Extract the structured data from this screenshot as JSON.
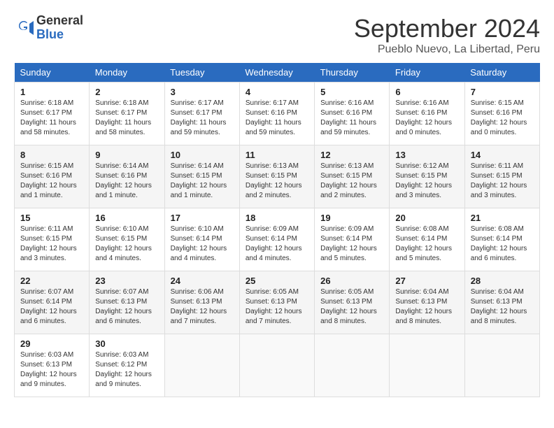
{
  "logo": {
    "general": "General",
    "blue": "Blue"
  },
  "header": {
    "month": "September 2024",
    "location": "Pueblo Nuevo, La Libertad, Peru"
  },
  "days_of_week": [
    "Sunday",
    "Monday",
    "Tuesday",
    "Wednesday",
    "Thursday",
    "Friday",
    "Saturday"
  ],
  "weeks": [
    [
      {
        "day": "1",
        "sunrise": "6:18 AM",
        "sunset": "6:17 PM",
        "daylight": "11 hours and 58 minutes."
      },
      {
        "day": "2",
        "sunrise": "6:18 AM",
        "sunset": "6:17 PM",
        "daylight": "11 hours and 58 minutes."
      },
      {
        "day": "3",
        "sunrise": "6:17 AM",
        "sunset": "6:17 PM",
        "daylight": "11 hours and 59 minutes."
      },
      {
        "day": "4",
        "sunrise": "6:17 AM",
        "sunset": "6:16 PM",
        "daylight": "11 hours and 59 minutes."
      },
      {
        "day": "5",
        "sunrise": "6:16 AM",
        "sunset": "6:16 PM",
        "daylight": "11 hours and 59 minutes."
      },
      {
        "day": "6",
        "sunrise": "6:16 AM",
        "sunset": "6:16 PM",
        "daylight": "12 hours and 0 minutes."
      },
      {
        "day": "7",
        "sunrise": "6:15 AM",
        "sunset": "6:16 PM",
        "daylight": "12 hours and 0 minutes."
      }
    ],
    [
      {
        "day": "8",
        "sunrise": "6:15 AM",
        "sunset": "6:16 PM",
        "daylight": "12 hours and 1 minute."
      },
      {
        "day": "9",
        "sunrise": "6:14 AM",
        "sunset": "6:16 PM",
        "daylight": "12 hours and 1 minute."
      },
      {
        "day": "10",
        "sunrise": "6:14 AM",
        "sunset": "6:15 PM",
        "daylight": "12 hours and 1 minute."
      },
      {
        "day": "11",
        "sunrise": "6:13 AM",
        "sunset": "6:15 PM",
        "daylight": "12 hours and 2 minutes."
      },
      {
        "day": "12",
        "sunrise": "6:13 AM",
        "sunset": "6:15 PM",
        "daylight": "12 hours and 2 minutes."
      },
      {
        "day": "13",
        "sunrise": "6:12 AM",
        "sunset": "6:15 PM",
        "daylight": "12 hours and 3 minutes."
      },
      {
        "day": "14",
        "sunrise": "6:11 AM",
        "sunset": "6:15 PM",
        "daylight": "12 hours and 3 minutes."
      }
    ],
    [
      {
        "day": "15",
        "sunrise": "6:11 AM",
        "sunset": "6:15 PM",
        "daylight": "12 hours and 3 minutes."
      },
      {
        "day": "16",
        "sunrise": "6:10 AM",
        "sunset": "6:15 PM",
        "daylight": "12 hours and 4 minutes."
      },
      {
        "day": "17",
        "sunrise": "6:10 AM",
        "sunset": "6:14 PM",
        "daylight": "12 hours and 4 minutes."
      },
      {
        "day": "18",
        "sunrise": "6:09 AM",
        "sunset": "6:14 PM",
        "daylight": "12 hours and 4 minutes."
      },
      {
        "day": "19",
        "sunrise": "6:09 AM",
        "sunset": "6:14 PM",
        "daylight": "12 hours and 5 minutes."
      },
      {
        "day": "20",
        "sunrise": "6:08 AM",
        "sunset": "6:14 PM",
        "daylight": "12 hours and 5 minutes."
      },
      {
        "day": "21",
        "sunrise": "6:08 AM",
        "sunset": "6:14 PM",
        "daylight": "12 hours and 6 minutes."
      }
    ],
    [
      {
        "day": "22",
        "sunrise": "6:07 AM",
        "sunset": "6:14 PM",
        "daylight": "12 hours and 6 minutes."
      },
      {
        "day": "23",
        "sunrise": "6:07 AM",
        "sunset": "6:13 PM",
        "daylight": "12 hours and 6 minutes."
      },
      {
        "day": "24",
        "sunrise": "6:06 AM",
        "sunset": "6:13 PM",
        "daylight": "12 hours and 7 minutes."
      },
      {
        "day": "25",
        "sunrise": "6:05 AM",
        "sunset": "6:13 PM",
        "daylight": "12 hours and 7 minutes."
      },
      {
        "day": "26",
        "sunrise": "6:05 AM",
        "sunset": "6:13 PM",
        "daylight": "12 hours and 8 minutes."
      },
      {
        "day": "27",
        "sunrise": "6:04 AM",
        "sunset": "6:13 PM",
        "daylight": "12 hours and 8 minutes."
      },
      {
        "day": "28",
        "sunrise": "6:04 AM",
        "sunset": "6:13 PM",
        "daylight": "12 hours and 8 minutes."
      }
    ],
    [
      {
        "day": "29",
        "sunrise": "6:03 AM",
        "sunset": "6:13 PM",
        "daylight": "12 hours and 9 minutes."
      },
      {
        "day": "30",
        "sunrise": "6:03 AM",
        "sunset": "6:12 PM",
        "daylight": "12 hours and 9 minutes."
      },
      null,
      null,
      null,
      null,
      null
    ]
  ]
}
